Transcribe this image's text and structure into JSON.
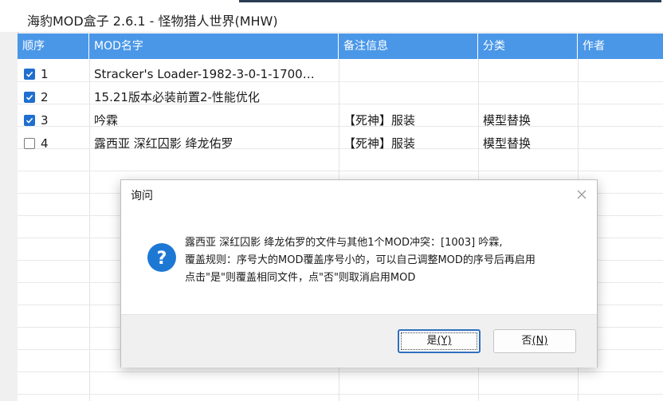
{
  "window": {
    "title": "海豹MOD盒子 2.6.1 - 怪物猎人世界(MHW)"
  },
  "table": {
    "headers": [
      "顺序",
      "MOD名字",
      "备注信息",
      "分类",
      "作者"
    ],
    "rows": [
      {
        "checked": true,
        "order": "1",
        "name": "Stracker's Loader-1982-3-0-1-1700…",
        "note": "",
        "category": "",
        "author": ""
      },
      {
        "checked": true,
        "order": "2",
        "name": "15.21版本必装前置2-性能优化",
        "note": "",
        "category": "",
        "author": ""
      },
      {
        "checked": true,
        "order": "3",
        "name": "吟霖",
        "note": "【死神】服装",
        "category": "模型替换",
        "author": ""
      },
      {
        "checked": false,
        "order": "4",
        "name": "露西亚 深红囚影 绛龙佑罗",
        "note": "【死神】服装",
        "category": "模型替换",
        "author": ""
      }
    ]
  },
  "dialog": {
    "title": "询问",
    "icon": "question-icon",
    "message_lines": [
      "露西亚 深红囚影 绛龙佑罗的文件与其他1个MOD冲突：[1003] 吟霖,",
      "覆盖规则：序号大的MOD覆盖序号小的，可以自己调整MOD的序号后再启用",
      "点击\"是\"则覆盖相同文件，点\"否\"则取消启用MOD"
    ],
    "yes_label": "是",
    "yes_shortcut": "(Y)",
    "no_label": "否",
    "no_shortcut": "(N)"
  },
  "colors": {
    "header_bg": "#4a97e8",
    "checkbox_on": "#1f6fd0",
    "primary_border": "#2f6fbe",
    "dialog_footer": "#f0f0f0"
  }
}
